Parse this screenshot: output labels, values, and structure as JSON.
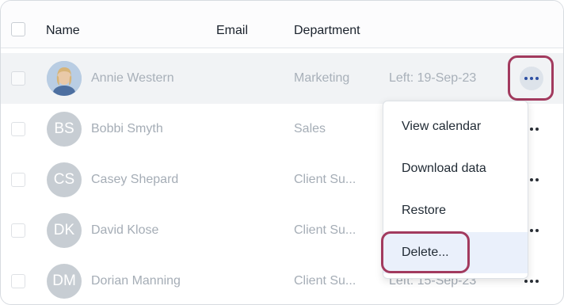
{
  "table": {
    "columns": {
      "name": "Name",
      "email": "Email",
      "department": "Department"
    },
    "rows": [
      {
        "initials": "",
        "avatar": "photo",
        "name": "Annie Western",
        "department": "Marketing",
        "status": "Left: 19-Sep-23"
      },
      {
        "initials": "BS",
        "avatar": "initials",
        "name": "Bobbi Smyth",
        "department": "Sales",
        "status": ""
      },
      {
        "initials": "CS",
        "avatar": "initials",
        "name": "Casey Shepard",
        "department": "Client Su...",
        "status": ""
      },
      {
        "initials": "DK",
        "avatar": "initials",
        "name": "David Klose",
        "department": "Client Su...",
        "status": ""
      },
      {
        "initials": "DM",
        "avatar": "initials",
        "name": "Dorian Manning",
        "department": "Client Su...",
        "status": "Left: 15-Sep-23"
      }
    ]
  },
  "menu": {
    "items": [
      "View calendar",
      "Download data",
      "Restore",
      "Delete..."
    ],
    "hovered_index": 3
  },
  "colors": {
    "accent": "#2d4fa3",
    "focus_ring": "#a23a5e",
    "menu_hover": "#eaf0fb",
    "row_highlight": "#f1f3f5"
  },
  "icons": {
    "more": "more-horizontal-icon",
    "select": "checkbox"
  }
}
